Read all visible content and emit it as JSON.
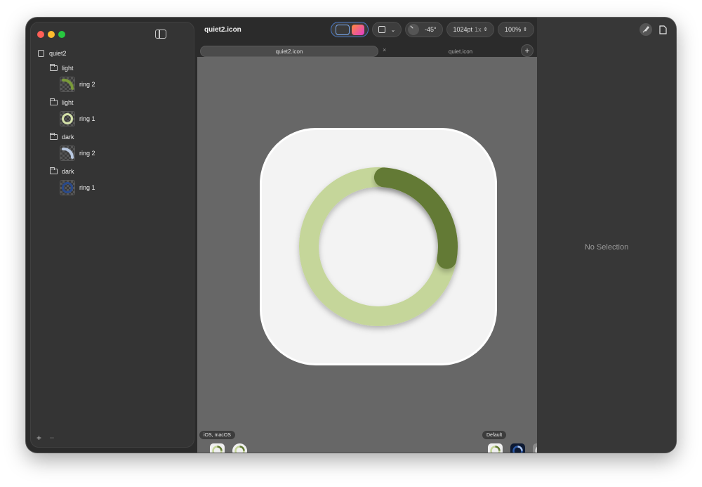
{
  "window": {
    "document_title": "quiet2.icon"
  },
  "sidebar": {
    "root_label": "quiet2",
    "items": [
      {
        "type": "folder",
        "label": "light"
      },
      {
        "type": "layer",
        "label": "ring 2"
      },
      {
        "type": "folder",
        "label": "light"
      },
      {
        "type": "layer",
        "label": "ring 1"
      },
      {
        "type": "folder",
        "label": "dark"
      },
      {
        "type": "layer",
        "label": "ring 2"
      },
      {
        "type": "folder",
        "label": "dark"
      },
      {
        "type": "layer",
        "label": "ring 1"
      }
    ],
    "add_label": "+",
    "remove_label": "−"
  },
  "toolbar": {
    "angle_label": "-45°",
    "size_label": "1024pt",
    "scale_label": "1x",
    "zoom_label": "100%"
  },
  "tabs": [
    {
      "label": "quiet2.icon",
      "active": true
    },
    {
      "label": "quiet.icon",
      "active": false
    }
  ],
  "tab_close_glyph": "×",
  "new_tab_glyph": "+",
  "canvas": {
    "platform_label": "iOS, macOS",
    "appearance_label": "Default",
    "ring_progress": 0.25,
    "colors": {
      "ring_track": "#c5d69a",
      "ring_arc": "#647a35",
      "icon_bg": "#f3f3f3"
    }
  },
  "inspector": {
    "empty_label": "No Selection"
  }
}
